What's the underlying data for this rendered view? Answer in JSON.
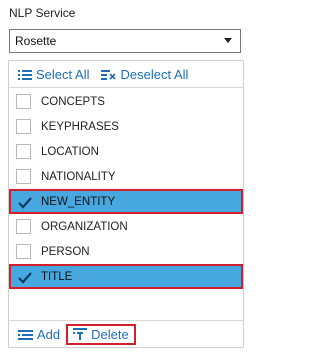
{
  "header": {
    "label": "NLP Service"
  },
  "service_select": {
    "value": "Rosette"
  },
  "toolbar": {
    "select_all": "Select All",
    "deselect_all": "Deselect All"
  },
  "entities": [
    {
      "label": "CONCEPTS",
      "checked": false
    },
    {
      "label": "KEYPHRASES",
      "checked": false
    },
    {
      "label": "LOCATION",
      "checked": false
    },
    {
      "label": "NATIONALITY",
      "checked": false
    },
    {
      "label": "NEW_ENTITY",
      "checked": true
    },
    {
      "label": "ORGANIZATION",
      "checked": false
    },
    {
      "label": "PERSON",
      "checked": false
    },
    {
      "label": "TITLE",
      "checked": true
    }
  ],
  "footer": {
    "add": "Add",
    "delete": "Delete"
  },
  "colors": {
    "accent": "#1e6fb8",
    "selection": "#46a8de",
    "highlight_border": "#d21f2b"
  }
}
